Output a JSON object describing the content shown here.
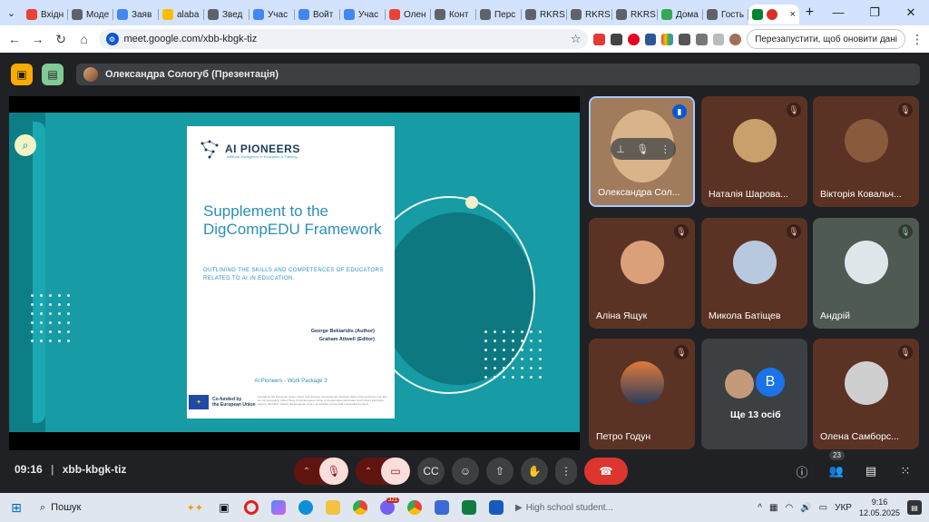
{
  "browser": {
    "tabs": [
      {
        "label": "Вхідн",
        "color": "#ea4335"
      },
      {
        "label": "Моде",
        "color": "#5f6368"
      },
      {
        "label": "Заяв",
        "color": "#4285f4"
      },
      {
        "label": "alaba",
        "color": "#fbbc04"
      },
      {
        "label": "Звед",
        "color": "#5f6368"
      },
      {
        "label": "Учас",
        "color": "#4285f4"
      },
      {
        "label": "Войт",
        "color": "#4285f4"
      },
      {
        "label": "Учас",
        "color": "#4285f4"
      },
      {
        "label": "Олен",
        "color": "#ea4335"
      },
      {
        "label": "Конт",
        "color": "#5f6368"
      },
      {
        "label": "Перс",
        "color": "#5f6368"
      },
      {
        "label": "RKRS",
        "color": "#5f6368"
      },
      {
        "label": "RKRS",
        "color": "#5f6368"
      },
      {
        "label": "RKRS",
        "color": "#5f6368"
      },
      {
        "label": "Дома",
        "color": "#34a853"
      },
      {
        "label": "Гость",
        "color": "#5f6368"
      }
    ],
    "active_tab_close": "×",
    "new_tab": "+",
    "url": "meet.google.com/xbb-kbgk-tiz",
    "relaunch_label": "Перезапустити, щоб оновити дані"
  },
  "meet": {
    "presenter_label": "Олександра Сологуб (Презентація)",
    "meeting_code": "xbb-kbgk-tiz",
    "time": "09:16",
    "participants_count": "23",
    "others_label": "Ще 13 осіб",
    "others_initial": "B",
    "tiles": [
      {
        "name": "Олександра Сол...",
        "face": "#d9b48a"
      },
      {
        "name": "Наталія Шарова...",
        "face": "#c9a06c"
      },
      {
        "name": "Вікторія Ковальч...",
        "face": "#8a5a3c"
      },
      {
        "name": "Аліна Ящук",
        "face": "#d9a07a"
      },
      {
        "name": "Микола Батіщев",
        "face": "#b7c9de"
      },
      {
        "name": "Андрій",
        "face": "#dfe6ea"
      },
      {
        "name": "Петро Годун",
        "face": "#e07a3c"
      },
      {
        "name": "Олена Самборс...",
        "face": "#cfcfcf"
      }
    ]
  },
  "slide": {
    "logo": "AI PIONEERS",
    "logo_sub": "Artificial Intelligence in Education & Training",
    "title": "Supplement to the DigCompEDU Framework",
    "outline": "OUTLINING THE SKILLS AND COMPETENCES OF EDUCATORS RELATED TO AI IN EDUCATION.",
    "author1": "George Bekiaridis (Author)",
    "author2": "Graham Attwell (Editor)",
    "work_package": "AI Pioneers - Work Package 3",
    "eu_label_1": "Co-funded by",
    "eu_label_2": "the European Union",
    "eu_fine": "Funded by the European Union. Views and opinions expressed are however those of the author(s) only and do not necessarily reflect those of the European Union or the European Education and Culture Executive Agency (EACEA). Neither the European Union nor EACEA can be held responsible for them."
  },
  "taskbar": {
    "search": "Пошук",
    "media": "High school student...",
    "language": "УКР",
    "clock_time": "9:16",
    "clock_date": "12.05.2025",
    "notif_badge": "321"
  }
}
